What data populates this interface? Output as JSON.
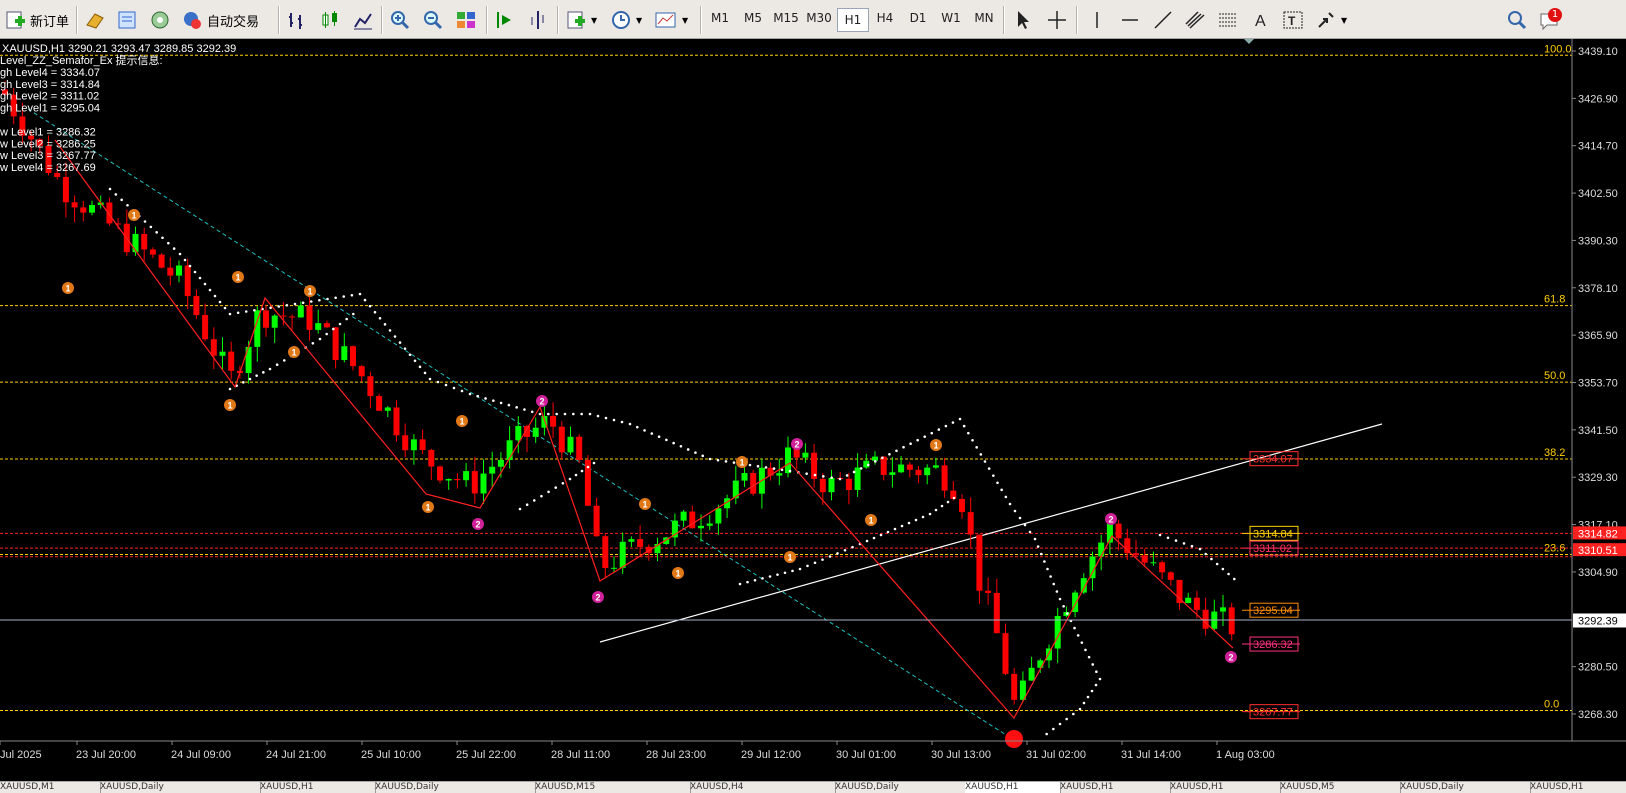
{
  "toolbar": {
    "new_order": "新订单",
    "auto_trade": "自动交易",
    "timeframes": [
      "M1",
      "M5",
      "M15",
      "M30",
      "H1",
      "H4",
      "D1",
      "W1",
      "MN"
    ],
    "active_timeframe": "H1",
    "notification_count": "1",
    "icons": [
      "new-order-icon",
      "market-watch-icon",
      "data-window-icon",
      "navigator-icon",
      "auto-trade-icon",
      "bar-chart-icon",
      "candlestick-icon",
      "line-chart-icon",
      "zoom-in-icon",
      "zoom-out-icon",
      "tile-windows-icon",
      "autoscroll-icon",
      "chart-shift-icon",
      "indicators-icon",
      "periods-icon",
      "templates-icon",
      "cursor-icon",
      "crosshair-icon",
      "vertical-line-icon",
      "horizontal-line-icon",
      "trendline-icon",
      "equidistant-channel-icon",
      "fibonacci-icon",
      "text-icon",
      "text-label-icon",
      "arrows-icon",
      "search-icon",
      "notification-icon"
    ]
  },
  "chart": {
    "symbol_line": "XAUUSD,H1  3290.21 3293.47 3289.85 3292.39",
    "info_lines": [
      "Level_ZZ_Semafor_Ex 提示信息:",
      "gh Level4 = 3334.07",
      "gh Level3 = 3314.84",
      "gh Level2 = 3311.02",
      "gh Level1 = 3295.04",
      "",
      "w Level1 = 3286.32",
      "w Level2 = 3286.25",
      "w Level3 = 3267.77",
      "w Level4 = 3267.69"
    ],
    "price_axis": [
      "3439.10",
      "3426.90",
      "3414.70",
      "3402.50",
      "3390.30",
      "3378.10",
      "3365.90",
      "3353.70",
      "3341.50",
      "3329.30",
      "3317.10",
      "3304.90",
      "3280.50",
      "3268.30"
    ],
    "current_price": "3292.39",
    "fib_levels": [
      {
        "label": "100.0",
        "price": 3438.0
      },
      {
        "label": "61.8",
        "price": 3373.5
      },
      {
        "label": "50.0",
        "price": 3353.8
      },
      {
        "label": "38.2",
        "price": 3334.0
      },
      {
        "label": "23.6",
        "price": 3309.4
      },
      {
        "label": "0.0",
        "price": 3269.2
      }
    ],
    "level_tags": [
      {
        "text": "3334.07",
        "color": "#ff3030",
        "price": 3334.07
      },
      {
        "text": "3314.84",
        "color": "#ffd000",
        "price": 3314.84
      },
      {
        "text": "3311.02",
        "color": "#ff3060",
        "price": 3311.02
      },
      {
        "text": "3295.04",
        "color": "#ff8c00",
        "price": 3295.04
      },
      {
        "text": "3286.32",
        "color": "#ff3080",
        "price": 3286.32
      },
      {
        "text": "3267.77",
        "color": "#ff3030",
        "price": 3268.9
      }
    ],
    "axis_badges": [
      {
        "text": "3314.82",
        "color": "#ff2020",
        "price": 3314.82
      },
      {
        "text": "3310.51",
        "color": "#ff2020",
        "price": 3310.51
      }
    ],
    "time_axis": [
      "Jul 2025",
      "23 Jul 20:00",
      "24 Jul 09:00",
      "24 Jul 21:00",
      "25 Jul 10:00",
      "25 Jul 22:00",
      "28 Jul 11:00",
      "28 Jul 23:00",
      "29 Jul 12:00",
      "30 Jul 01:00",
      "30 Jul 13:00",
      "31 Jul 02:00",
      "31 Jul 14:00",
      "1 Aug 03:00"
    ],
    "colors": {
      "bull": "#00ff00",
      "bear": "#ff0000",
      "fib": "#ffd000",
      "zigzag": "#ff2020",
      "trendline": "#ffffff",
      "channel": "#20c0c0",
      "grid": "#444444"
    }
  },
  "tabs": [
    "XAUUSD,M1",
    "XAUUSD,Daily",
    "XAUUSD,H1",
    "XAUUSD,Daily",
    "XAUUSD,M15",
    "XAUUSD,H4",
    "XAUUSD,Daily",
    "XAUUSD,H1",
    "XAUUSD,H1",
    "XAUUSD,H1",
    "XAUUSD,M5",
    "XAUUSD,Daily",
    "XAUUSD,H1"
  ]
}
